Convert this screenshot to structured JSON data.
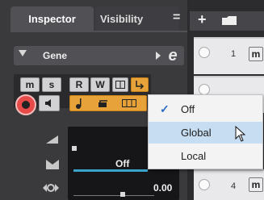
{
  "inspector": {
    "tabs": [
      "Inspector",
      "Visibility"
    ],
    "menu_glyph": "=",
    "track_name": "Gene",
    "edit_glyph": "e",
    "buttons_row1": [
      "m",
      "s",
      "R",
      "W"
    ],
    "pan_value": "Off",
    "io_value": "0.00"
  },
  "dropdown": {
    "items": [
      "Off",
      "Global",
      "Local"
    ],
    "checked": "Off",
    "hovered": "Global"
  },
  "tracklist": {
    "add_glyph": "+",
    "track_numbers": [
      "1",
      "4"
    ],
    "mute_label": "m"
  },
  "colors": {
    "accent_orange": "#e8a23a",
    "record_red": "#e84a4a",
    "highlight": "#c7ddf2",
    "pan_bar": "#3aa3c9"
  }
}
